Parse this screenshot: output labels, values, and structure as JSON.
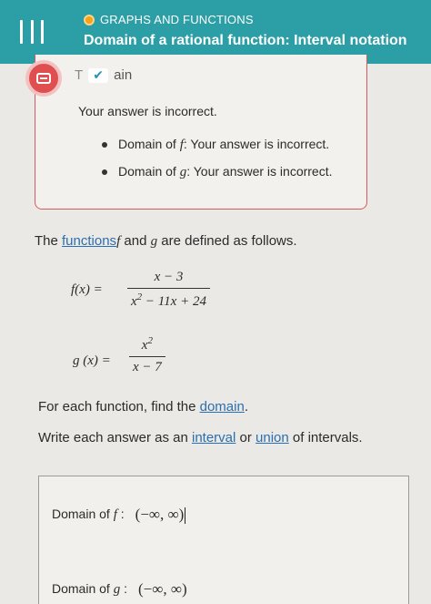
{
  "header": {
    "topic": "GRAPHS AND FUNCTIONS",
    "title": "Domain of a rational function: Interval notation"
  },
  "feedback": {
    "tab_label_prefix": "T",
    "tab_label_suffix": "ain",
    "message": "Your answer is incorrect.",
    "items": [
      {
        "prefix": "Domain of ",
        "var": "f",
        "suffix": ": Your answer is incorrect."
      },
      {
        "prefix": "Domain of ",
        "var": "g",
        "suffix": ": Your answer is incorrect."
      }
    ]
  },
  "problem": {
    "intro_prefix": "The ",
    "intro_link": "functions",
    "intro_f": "f",
    "intro_mid": " and ",
    "intro_g": "g",
    "intro_suffix": " are defined as follows.",
    "f_lhs": "f(x)  =",
    "f_num": "x − 3",
    "f_den_a": "x",
    "f_den_exp": "2",
    "f_den_b": " − 11x + 24",
    "g_lhs": "g (x)  =",
    "g_num": "x",
    "g_num_exp": "2",
    "g_den": "x − 7",
    "instr1_prefix": "For each function, find the ",
    "instr1_link": "domain",
    "instr1_suffix": ".",
    "instr2_prefix": "Write each answer as an ",
    "instr2_link1": "interval",
    "instr2_mid": " or ",
    "instr2_link2": "union",
    "instr2_suffix": " of intervals."
  },
  "answers": {
    "f_label_prefix": "Domain of ",
    "f_label_var": "f",
    "f_label_suffix": " :",
    "f_value": "(−∞, ∞)",
    "g_label_prefix": "Domain of ",
    "g_label_var": "g",
    "g_label_suffix": " :",
    "g_value": "(−∞, ∞)"
  }
}
